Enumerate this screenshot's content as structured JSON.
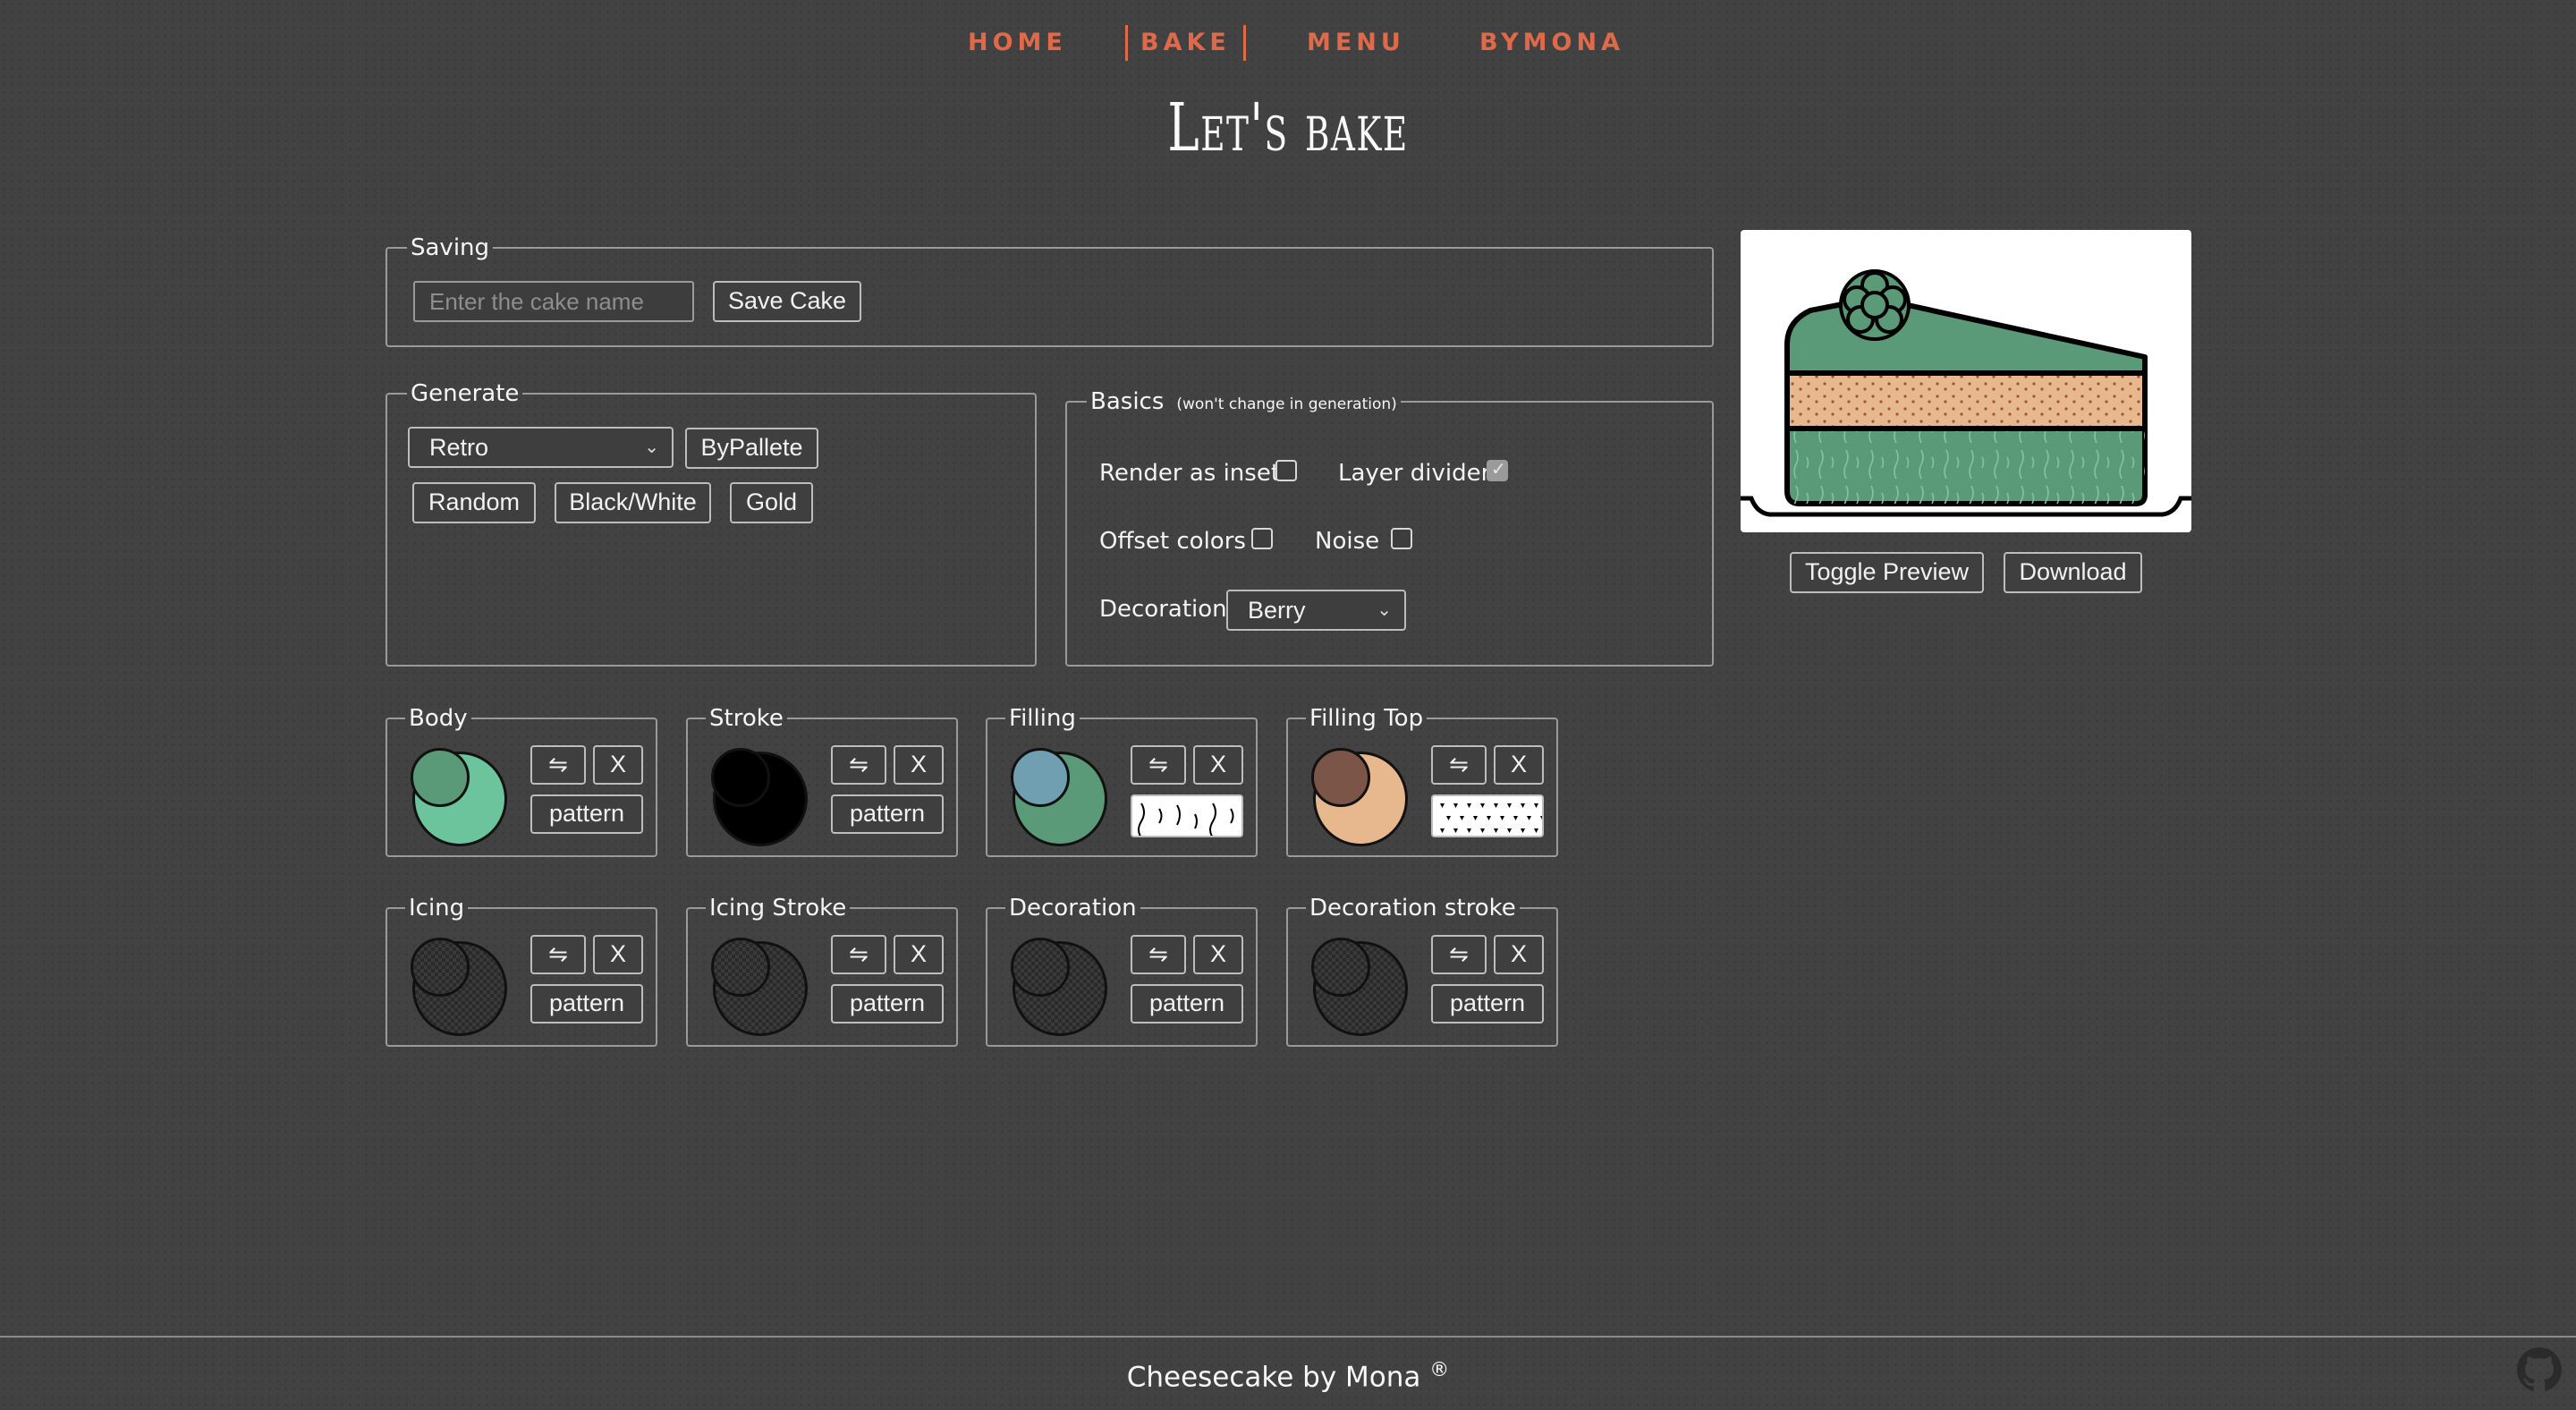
{
  "nav": {
    "items": [
      {
        "label": "HOME",
        "active": false
      },
      {
        "label": "BAKE",
        "active": true
      },
      {
        "label": "MENU",
        "active": false
      },
      {
        "label": "BYMONA",
        "active": false
      }
    ]
  },
  "page": {
    "title": "Let's bake"
  },
  "saving": {
    "legend": "Saving",
    "name_placeholder": "Enter the cake name",
    "name_value": "",
    "save_label": "Save Cake"
  },
  "generate": {
    "legend": "Generate",
    "palette_selected": "Retro",
    "by_palette_label": "ByPallete",
    "random_label": "Random",
    "black_white_label": "Black/White",
    "gold_label": "Gold"
  },
  "basics": {
    "legend": "Basics",
    "note": "(won't change in generation)",
    "render_inset_label": "Render as inset",
    "render_inset_checked": false,
    "layer_divider_label": "Layer divider",
    "layer_divider_checked": true,
    "offset_colors_label": "Offset colors",
    "offset_colors_checked": false,
    "noise_label": "Noise",
    "noise_checked": false,
    "decoration_label": "Decoration",
    "decoration_selected": "Berry"
  },
  "color_cards": [
    {
      "label": "Body",
      "front": "#5a9a78",
      "back": "#6cc49c",
      "pattern": null
    },
    {
      "label": "Stroke",
      "front": "#000000",
      "back": "#000000",
      "pattern": null
    },
    {
      "label": "Filling",
      "front": "#6f9fb0",
      "back": "#5a9a78",
      "pattern": "squiggle"
    },
    {
      "label": "Filling Top",
      "front": "#7a5548",
      "back": "#e7b88e",
      "pattern": "dots"
    },
    {
      "label": "Icing",
      "front": "checker",
      "back": "checker",
      "pattern": null
    },
    {
      "label": "Icing Stroke",
      "front": "checker",
      "back": "checker",
      "pattern": null
    },
    {
      "label": "Decoration",
      "front": "checker",
      "back": "checker",
      "pattern": null
    },
    {
      "label": "Decoration stroke",
      "front": "checker",
      "back": "checker",
      "pattern": null
    }
  ],
  "card_buttons": {
    "swap": "⇋",
    "clear": "X",
    "pattern": "pattern"
  },
  "preview": {
    "toggle_label": "Toggle Preview",
    "download_label": "Download"
  },
  "footer": {
    "text": "Cheesecake by Mona",
    "mark": "®"
  },
  "colors": {
    "background": "#424242",
    "nav_accent": "#e0694a",
    "cake_body": "#5a9a78",
    "cake_filling": "#e7b88e"
  },
  "icons": {
    "github": "github-icon",
    "swap": "swap-arrows-icon"
  }
}
